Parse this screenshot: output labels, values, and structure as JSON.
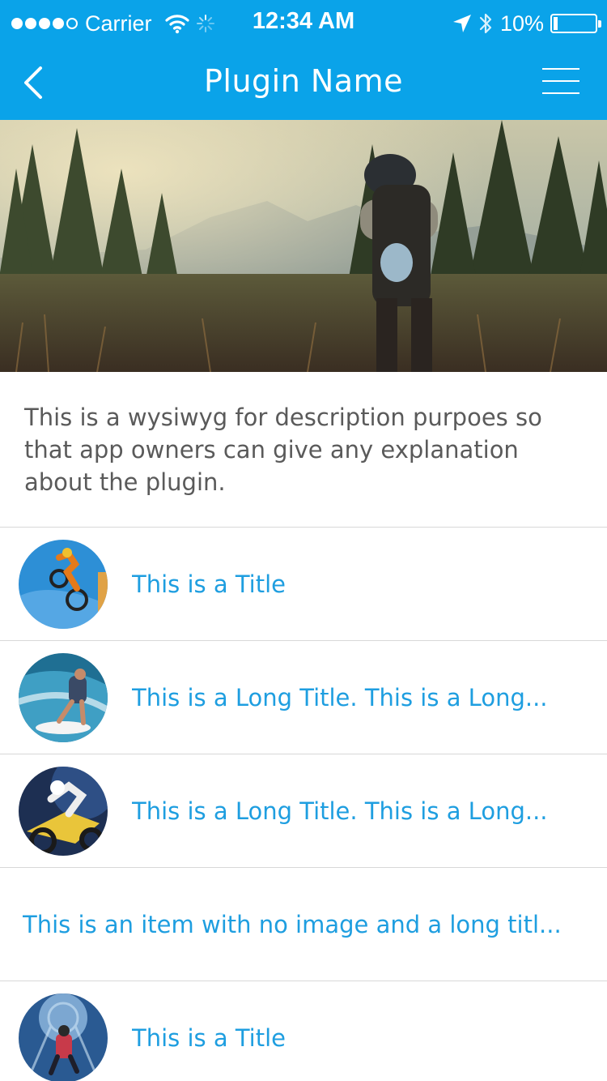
{
  "status_bar": {
    "carrier": "Carrier",
    "time": "12:34 AM",
    "battery": "10%",
    "battery_level": 0.1,
    "signal_bars_filled": 4,
    "signal_bars_total": 5,
    "icons": [
      "wifi-icon",
      "activity-spinner-icon",
      "location-arrow-icon",
      "bluetooth-icon",
      "battery-icon"
    ]
  },
  "nav": {
    "title": "Plugin Name",
    "back_icon": "chevron-left-icon",
    "menu_icon": "hamburger-menu-icon"
  },
  "hero": {
    "image": "hiker with backpack in forest at sunrise"
  },
  "description": "This is a wysiwyg for description purpoes so that app owners can give any explanation about the plugin.",
  "list": [
    {
      "title": "This is a Title",
      "image": "bmx rider mid-air"
    },
    {
      "title": "This is a Long Title. This is a Long...",
      "image": "surfer riding wave"
    },
    {
      "title": "This is a Long Title. This is a Long...",
      "image": "motocross rider"
    },
    {
      "title": "This is an item with no image and a long titl...",
      "image": ""
    },
    {
      "title": "This is a Title",
      "image": "skydiver in tunnel"
    }
  ],
  "colors": {
    "primary": "#0aa3e9",
    "link": "#1e9ee0",
    "text": "#5a5a5a",
    "divider": "#d8d8d8"
  }
}
